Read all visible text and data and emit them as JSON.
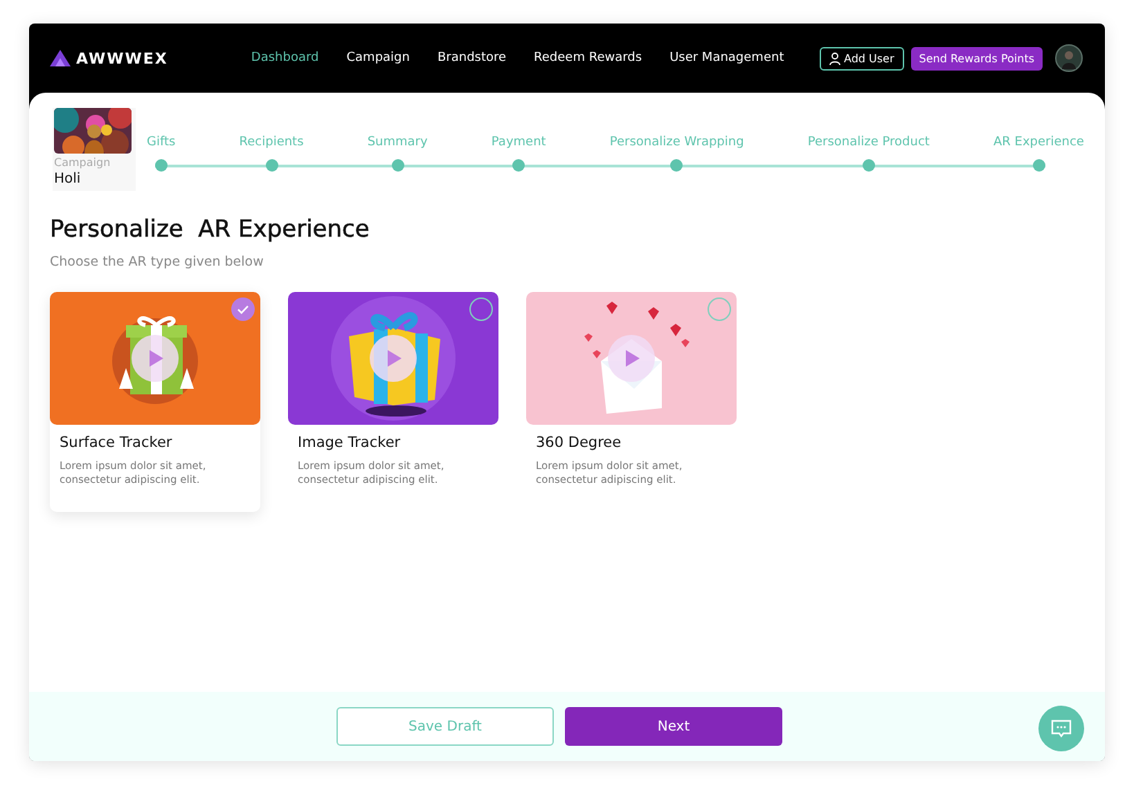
{
  "header": {
    "logo": "AWWWEX",
    "nav": [
      {
        "label": "Dashboard",
        "selected": true
      },
      {
        "label": "Campaign",
        "selected": false
      },
      {
        "label": "Brandstore",
        "selected": false
      },
      {
        "label": "Redeem Rewards",
        "selected": false
      },
      {
        "label": "User Management",
        "selected": false
      }
    ],
    "add_user": "Add User",
    "send_points": "Send Rewards Points"
  },
  "campaign": {
    "label": "Campaign",
    "name": "Holi"
  },
  "steps": [
    "Gifts",
    "Recipients",
    "Summary",
    "Payment",
    "Personalize Wrapping",
    "Personalize Product",
    "AR Experience"
  ],
  "title": "Personalize  AR Experience",
  "subtitle": "Choose the AR type given below",
  "cards": [
    {
      "kind": "surface",
      "title": "Surface Tracker",
      "description": "Lorem ipsum dolor sit amet, consectetur adipiscing elit.",
      "selected": true
    },
    {
      "title": "Image Tracker",
      "description": "Lorem ipsum dolor sit amet, consectetur adipiscing elit.",
      "selected": false
    },
    {
      "kind": "degree",
      "title": "360 Degree",
      "description": "Lorem ipsum dolor sit amet, consectetur adipiscing elit.",
      "selected": false
    }
  ],
  "footer": {
    "save_draft": "Save Draft",
    "next": "Next"
  }
}
